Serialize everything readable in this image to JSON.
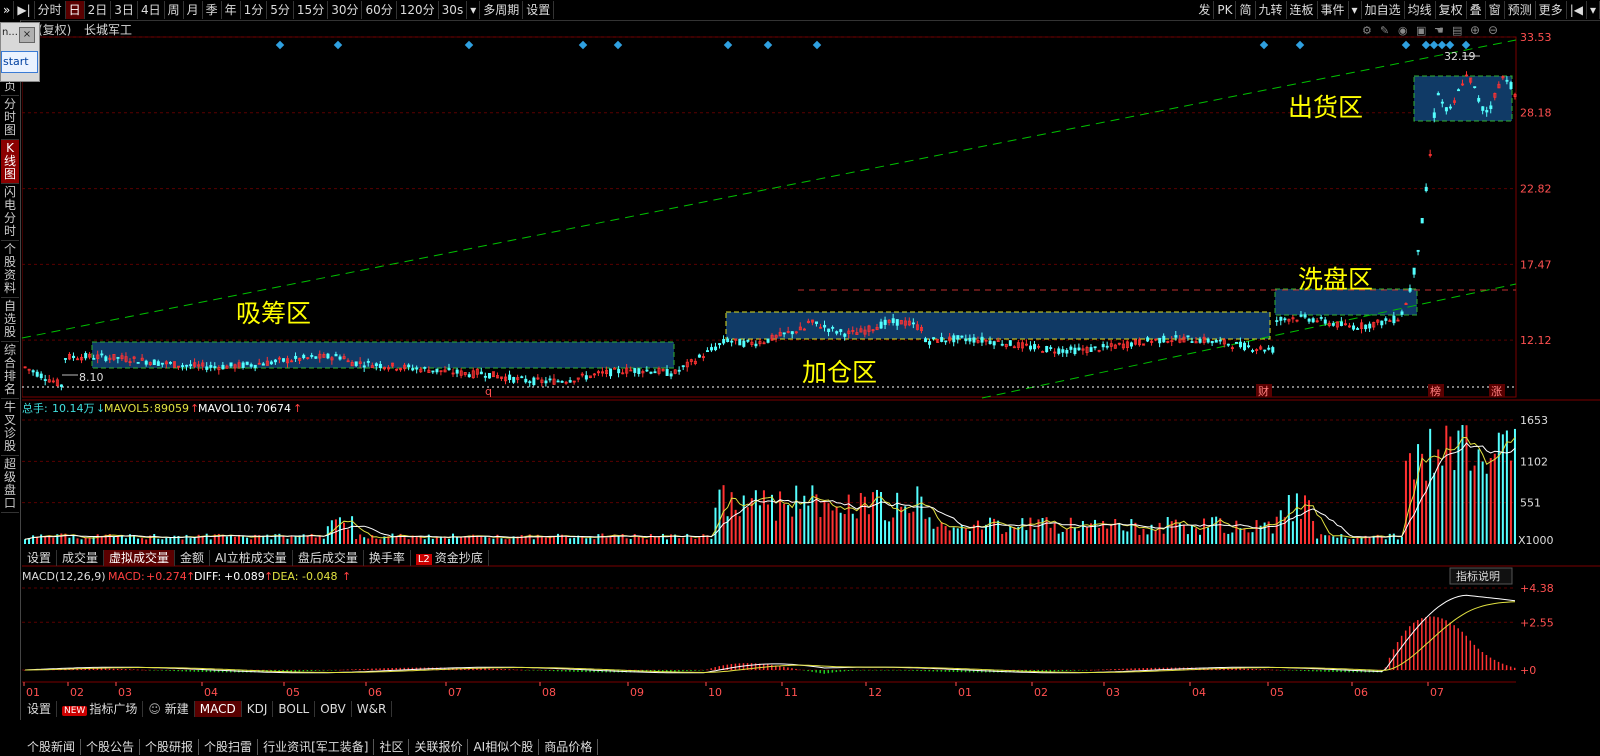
{
  "toolbar": {
    "left": [
      "分时",
      "日",
      "2日",
      "3日",
      "4日",
      "周",
      "月",
      "季",
      "年",
      "1分",
      "5分",
      "15分",
      "30分",
      "60分",
      "120分",
      "30s",
      "多周期",
      "设置"
    ],
    "right": [
      "发",
      "PK",
      "简",
      "九转",
      "连板",
      "事件",
      "加自选",
      "均线",
      "复权",
      "叠",
      "窗",
      "预测",
      "更多"
    ]
  },
  "sidebar": [
    "页",
    "分时图",
    "K线图",
    "闪电分时",
    "个股资料",
    "自选股",
    "综合排名",
    "牛叉诊股",
    "超级盘口"
  ],
  "popup": {
    "title": "n...",
    "close": "×",
    "button": "start"
  },
  "main": {
    "title_prefix": "能(复权)",
    "stock_name": "长城军工",
    "price_axis": [
      "33.53",
      "28.18",
      "22.82",
      "17.47",
      "12.12"
    ],
    "high_label": "32.19",
    "low_label": "8.10",
    "zone_labels": {
      "accumulate": "吸筹区",
      "add": "加仓区",
      "shakeout": "洗盘区",
      "ship": "出货区"
    },
    "event_markers": {
      "q": "q",
      "cai": "财",
      "bang": "榜",
      "zhang": "涨"
    }
  },
  "volume": {
    "label_total": "总手:",
    "total": "10.14万",
    "mavol5_label": "MAVOL5:",
    "mavol5": "89059",
    "mavol10_label": "MAVOL10:",
    "mavol10": "70674",
    "axis": [
      "1653",
      "1102",
      "551"
    ],
    "unit": "X1000"
  },
  "vol_tabs": [
    "设置",
    "成交量",
    "虚拟成交量",
    "金额",
    "AI立桩成交量",
    "盘后成交量",
    "换手率",
    "资金抄底"
  ],
  "vol_tab_badge": "L2",
  "macd": {
    "title": "MACD(12,26,9)",
    "macd_label": "MACD:",
    "macd": "+0.274",
    "diff_label": "DIFF:",
    "diff": "+0.089",
    "dea_label": "DEA:",
    "dea": "-0.048",
    "axis": [
      "+4.38",
      "+2.55",
      "+0"
    ],
    "explain": "指标说明"
  },
  "months": [
    "01",
    "02",
    "03",
    "04",
    "05",
    "06",
    "07",
    "08",
    "09",
    "10",
    "11",
    "12",
    "01",
    "02",
    "03",
    "04",
    "05",
    "06",
    "07"
  ],
  "indicator_tabs": {
    "settings": "设置",
    "new_badge": "NEW",
    "market": "指标广场",
    "create": "新建",
    "items": [
      "MACD",
      "KDJ",
      "BOLL",
      "OBV",
      "W&R"
    ]
  },
  "bottom_tabs": [
    "个股新闻",
    "个股公告",
    "个股研报",
    "个股扫雷",
    "行业资讯[军工装备]",
    "社区",
    "关联报价",
    "AI相似个股",
    "商品价格"
  ],
  "colors": {
    "up": "#ff3232",
    "down": "#54ffff",
    "zone_fill": "#103a66",
    "zone_label": "#ffff00",
    "trend_line": "#00c000",
    "grid": "#6a0000",
    "axis_text": "#ff5050"
  }
}
